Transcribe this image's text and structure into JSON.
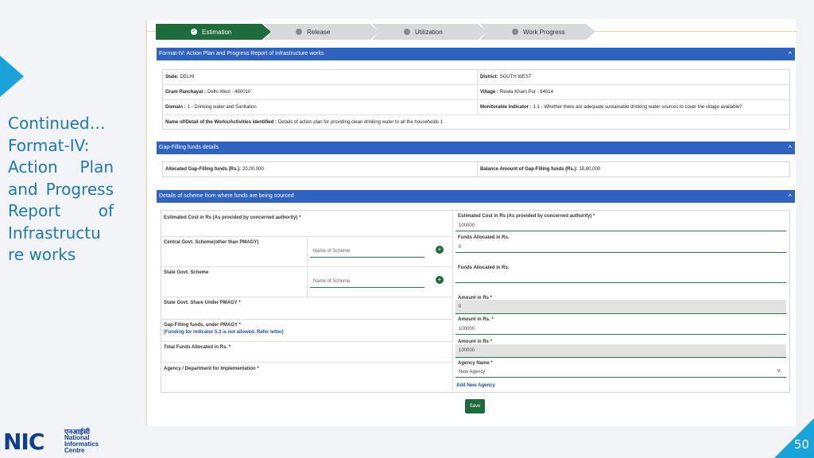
{
  "sidebar": {
    "title": "Continued… Format-IV: Action Plan and Progress Report of Infrastructu re works"
  },
  "footer": {
    "page_number": "50",
    "logo_text": "NIC",
    "logo_hindi": "एनआईसी",
    "logo_en_1": "National",
    "logo_en_2": "Informatics",
    "logo_en_3": "Centre"
  },
  "stepper": {
    "steps": [
      {
        "label": "Estimation",
        "state": "active"
      },
      {
        "label": "Release",
        "state": "inactive"
      },
      {
        "label": "Utilization",
        "state": "inactive"
      },
      {
        "label": "Work Progress",
        "state": "inactive"
      }
    ]
  },
  "panel1": {
    "title": "Format-IV: Action Plan and Progress Report of Infrastructure works",
    "state_label": "State:",
    "state_value": "DELHI",
    "district_label": "District:",
    "district_value": "SOUTH WEST",
    "gp_label": "Gram Panchayat :",
    "gp_value": "Delhi West - 450010",
    "village_label": "Village :",
    "village_value": "Rewla Kham Pur - 64014",
    "domain_label": "Domain :",
    "domain_value": "1 - Drinking water and Sanitation",
    "indicator_label": "Monitorable Indicator :",
    "indicator_value": "1.1 - Whether there are adequate sustainable drinking water sources to cover the village available?",
    "work_label": "Name of/Detail of the Works/Activities identified :",
    "work_value": "Details of action plan for providing clean drinking water to all the households 1"
  },
  "panel2": {
    "title": "Gap-Filling funds details",
    "allocated_label": "Allocated Gap-Filling funds (Rs.):",
    "allocated_value": "20,00,000",
    "balance_label": "Balance Amount of Gap-Filling funds (Rs.):",
    "balance_value": "18,80,000"
  },
  "panel3": {
    "title": "Details of scheme from where funds are being sourced",
    "estimated_cost_label": "Estimated Cost in Rs (As provided by concerned authority) *",
    "estimated_cost_field_label": "Estimated Cost in Rs (As provided by concerned authority) *",
    "estimated_cost_value": "100000",
    "central_scheme_label": "Central Govt. Scheme(other than PMAGY)",
    "central_scheme_placeholder": "Name of Scheme",
    "central_funds_label": "Funds Allocated in Rs.",
    "central_funds_value": "0",
    "state_scheme_label": "State Govt. Scheme",
    "state_scheme_placeholder": "Name of Scheme",
    "state_funds_label": "Funds Allocated in Rs.",
    "state_funds_value": "",
    "state_share_label": "State Govt. Share Under PMAGY *",
    "state_share_amount_label": "Amount in Rs *",
    "state_share_value": "0",
    "gap_filling_label": "Gap-Filling funds, under PMAGY *",
    "gap_filling_note": "(Funding for indicator 5.2 is not allowed. Refer letter)",
    "gap_filling_amount_label": "Amount in Rs. *",
    "gap_filling_value": "100000",
    "total_label": "Total Funds Allocated in Rs. *",
    "total_amount_label": "Amount in Rs *",
    "total_value": "100000",
    "agency_label": "Agency / Department for Implementation *",
    "agency_name_label": "Agency Name *",
    "agency_value": "New Agency",
    "add_agency_link": "Add New Agency",
    "save_label": "Save"
  }
}
